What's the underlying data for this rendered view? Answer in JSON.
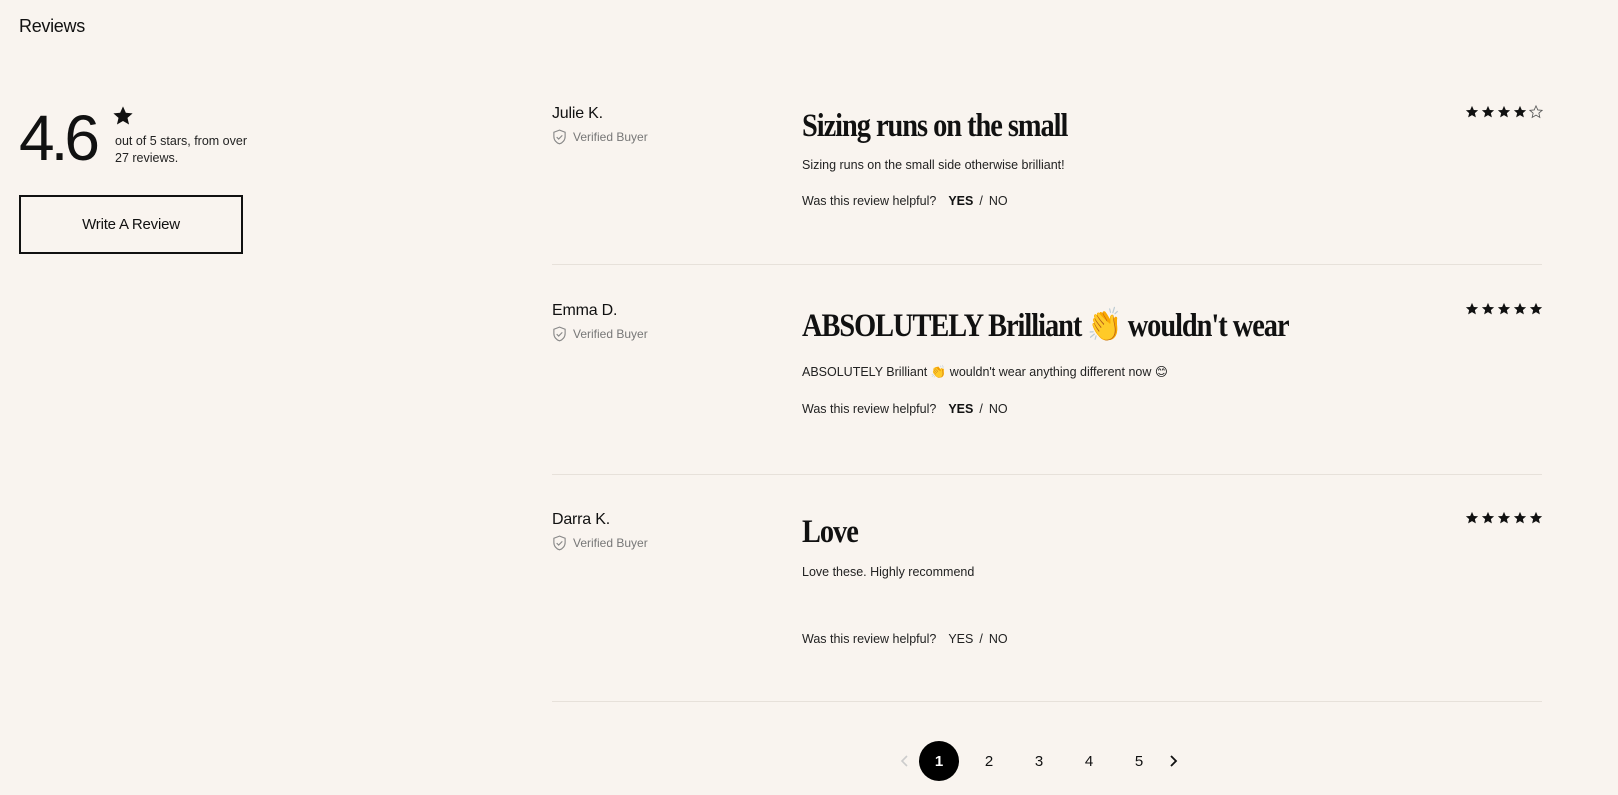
{
  "section_title": "Reviews",
  "summary": {
    "average": "4.6",
    "caption": "out of 5 stars, from over 27 reviews.",
    "write_review_label": "Write A Review"
  },
  "reviews": [
    {
      "author": "Julie K.",
      "verified_label": "Verified Buyer",
      "headline": "Sizing runs on the small",
      "body": "Sizing runs on the small side otherwise brilliant!",
      "rating": 4,
      "helpful_prompt": "Was this review helpful?",
      "yes_label": "YES",
      "no_label": "NO",
      "slash": "/"
    },
    {
      "author": "Emma D.",
      "verified_label": "Verified Buyer",
      "headline": "ABSOLUTELY Brilliant 👏 wouldn't wear",
      "body": "ABSOLUTELY Brilliant 👏 wouldn't wear anything different now 😊",
      "rating": 5,
      "helpful_prompt": "Was this review helpful?",
      "yes_label": "YES",
      "no_label": "NO",
      "slash": "/"
    },
    {
      "author": "Darra K.",
      "verified_label": "Verified Buyer",
      "headline": "Love",
      "body": "Love these. Highly recommend",
      "rating": 5,
      "helpful_prompt": "Was this review helpful?",
      "yes_label": "YES",
      "no_label": "NO",
      "slash": "/"
    }
  ],
  "pagination": {
    "pages": [
      "1",
      "2",
      "3",
      "4",
      "5"
    ],
    "current": "1"
  },
  "colors": {
    "background": "#f9f4ef",
    "text": "#111111",
    "muted": "#777777",
    "divider": "#e7e1da",
    "active_page_bg": "#000000"
  }
}
